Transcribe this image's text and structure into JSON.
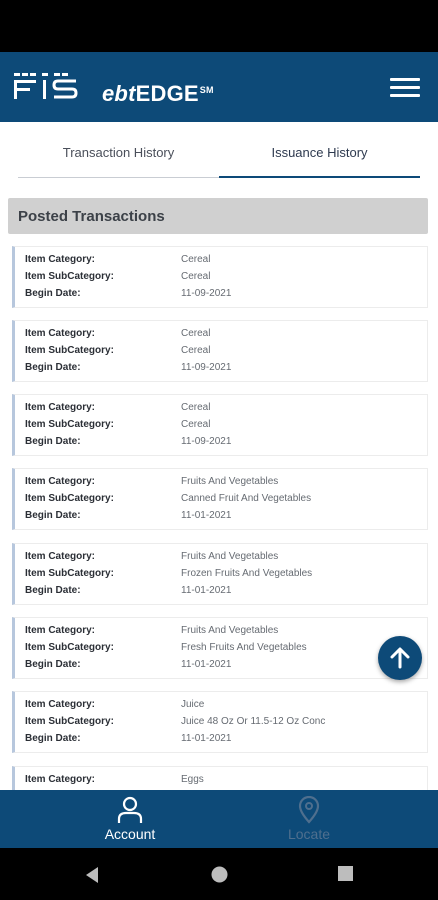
{
  "app": {
    "brand": {
      "logo_mark": "FIS",
      "product": "ebt",
      "product_suffix": "EDGE",
      "mark": "SM"
    }
  },
  "header": {
    "menu_icon": "hamburger-menu-icon"
  },
  "tabs": [
    {
      "label": "Transaction History",
      "active": false
    },
    {
      "label": "Issuance History",
      "active": true
    }
  ],
  "section": {
    "title": "Posted Transactions"
  },
  "labels": {
    "category": "Item Category:",
    "subcategory": "Item SubCategory:",
    "begin_date": "Begin Date:"
  },
  "transactions": [
    {
      "category": "Cereal",
      "subcategory": "Cereal",
      "begin_date": "11-09-2021"
    },
    {
      "category": "Cereal",
      "subcategory": "Cereal",
      "begin_date": "11-09-2021"
    },
    {
      "category": "Cereal",
      "subcategory": "Cereal",
      "begin_date": "11-09-2021"
    },
    {
      "category": "Fruits And Vegetables",
      "subcategory": "Canned Fruit And Vegetables",
      "begin_date": "11-01-2021"
    },
    {
      "category": "Fruits And Vegetables",
      "subcategory": "Frozen Fruits And Vegetables",
      "begin_date": "11-01-2021"
    },
    {
      "category": "Fruits And Vegetables",
      "subcategory": "Fresh Fruits And Vegetables",
      "begin_date": "11-01-2021"
    },
    {
      "category": "Juice",
      "subcategory": "Juice 48 Oz Or 11.5-12 Oz Conc",
      "begin_date": "11-01-2021"
    },
    {
      "category": "Eggs",
      "subcategory": "",
      "begin_date": ""
    }
  ],
  "fab": {
    "icon": "arrow-up-icon"
  },
  "bottom_nav": [
    {
      "label": "Account",
      "icon": "person-icon",
      "active": true
    },
    {
      "label": "Locate",
      "icon": "location-pin-icon",
      "active": false
    }
  ],
  "colors": {
    "brand_blue": "#0d4a78",
    "card_accent": "#b7c7dd",
    "section_gray": "#d0d0d0"
  }
}
